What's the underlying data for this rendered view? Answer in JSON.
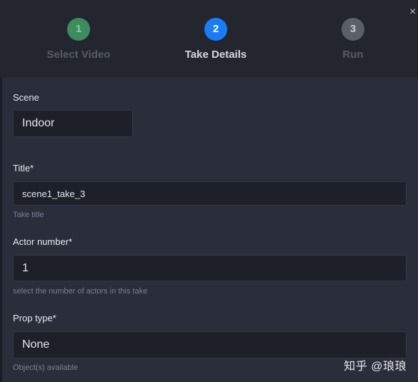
{
  "stepper": {
    "steps": [
      {
        "number": "1",
        "label": "Select Video",
        "circle_color": "#3d8b5f",
        "label_color": "#565b67",
        "number_color": "#8fc9a3"
      },
      {
        "number": "2",
        "label": "Take Details",
        "circle_color": "#1a7cf5",
        "label_color": "#d5d8df",
        "number_color": "#ffffff"
      },
      {
        "number": "3",
        "label": "Run",
        "circle_color": "#5a5f6a",
        "label_color": "#565b67",
        "number_color": "#c5c8ce"
      }
    ]
  },
  "close_icon": "×",
  "form": {
    "scene": {
      "label": "Scene",
      "value": "Indoor"
    },
    "title": {
      "label": "Title*",
      "value": "scene1_take_3",
      "helper": "Take title"
    },
    "actor_number": {
      "label": "Actor number*",
      "value": "1",
      "helper": "select the number of actors in this take"
    },
    "prop_type": {
      "label": "Prop type*",
      "value": "None",
      "helper": "Object(s) available"
    }
  },
  "watermark": "知乎 @琅琅"
}
